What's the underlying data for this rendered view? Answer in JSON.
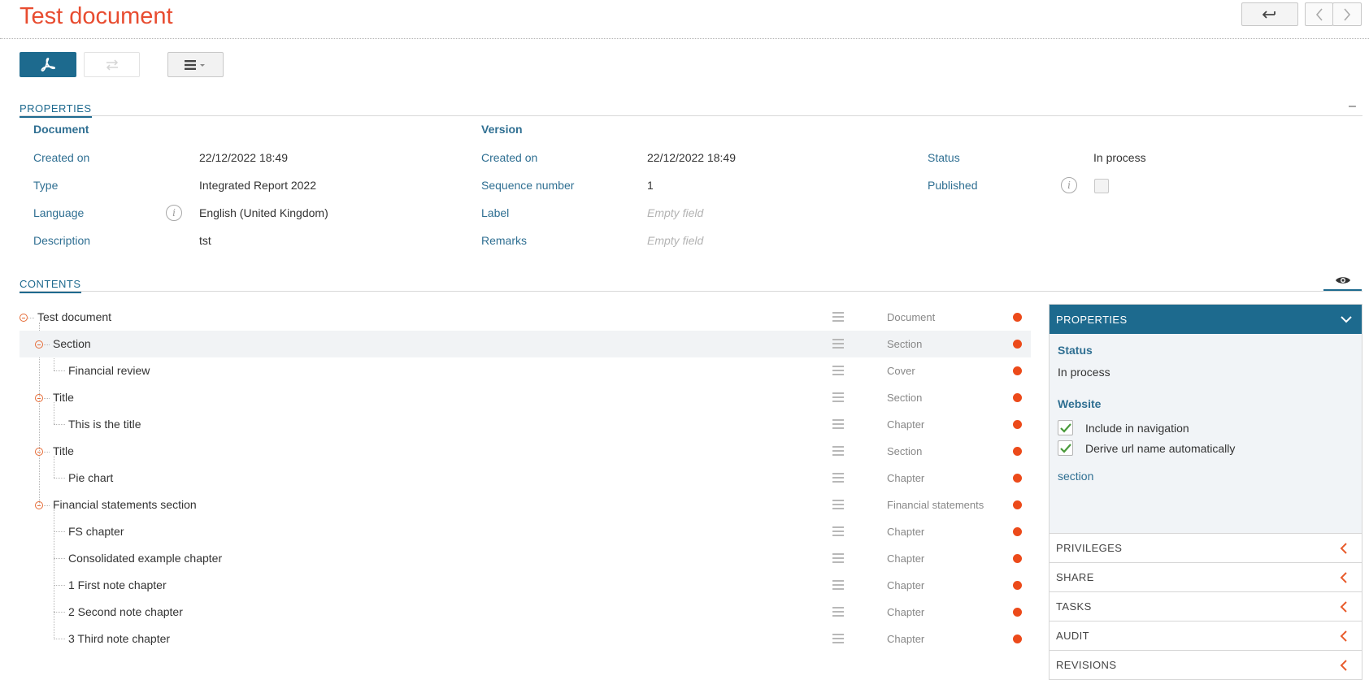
{
  "header": {
    "title": "Test document"
  },
  "nav": {
    "back_icon": "return-icon",
    "prev_icon": "chevron-left-icon",
    "next_icon": "chevron-right-icon"
  },
  "toolbar": {
    "pdf_icon": "pdf-icon",
    "swap_icon": "swap-icon",
    "menu_icon": "hamburger-menu-icon"
  },
  "properties": {
    "heading": "PROPERTIES",
    "collapse_symbol": "–",
    "document": {
      "heading": "Document",
      "rows": [
        {
          "label": "Created on",
          "value": "22/12/2022 18:49"
        },
        {
          "label": "Type",
          "value": "Integrated Report 2022"
        },
        {
          "label": "Language",
          "value": "English (United Kingdom)"
        },
        {
          "label": "Description",
          "value": "tst"
        }
      ]
    },
    "version": {
      "heading": "Version",
      "rows": [
        {
          "label": "Created on",
          "value": "22/12/2022 18:49"
        },
        {
          "label": "Sequence number",
          "value": "1"
        },
        {
          "label": "Label",
          "value": "Empty field"
        },
        {
          "label": "Remarks",
          "value": "Empty field"
        }
      ]
    },
    "status": {
      "rows": [
        {
          "label": "Status",
          "value": "In process"
        },
        {
          "label": "Published",
          "value": ""
        }
      ]
    }
  },
  "contents": {
    "heading": "CONTENTS",
    "rows": [
      {
        "label": "Test document",
        "type": "Document"
      },
      {
        "label": "Section",
        "type": "Section"
      },
      {
        "label": "Financial review",
        "type": "Cover"
      },
      {
        "label": "Title",
        "type": "Section"
      },
      {
        "label": "This is the title",
        "type": "Chapter"
      },
      {
        "label": "Title",
        "type": "Section"
      },
      {
        "label": "Pie chart",
        "type": "Chapter"
      },
      {
        "label": "Financial statements section",
        "type": "Financial statements"
      },
      {
        "label": "FS chapter",
        "type": "Chapter"
      },
      {
        "label": "Consolidated example chapter",
        "type": "Chapter"
      },
      {
        "label": "1 First note chapter",
        "type": "Chapter"
      },
      {
        "label": "2 Second note chapter",
        "type": "Chapter"
      },
      {
        "label": "3 Third note chapter",
        "type": "Chapter"
      }
    ]
  },
  "side_panel": {
    "header": "PROPERTIES",
    "status_heading": "Status",
    "status_value": "In process",
    "website_heading": "Website",
    "include_nav_label": "Include in navigation",
    "derive_url_label": "Derive url name automatically",
    "url_name": "section",
    "sections": [
      "PRIVILEGES",
      "SHARE",
      "TASKS",
      "AUDIT",
      "REVISIONS"
    ]
  },
  "colors": {
    "accent": "#1d6a8e",
    "title": "#e84c30",
    "status_dot": "#ec4a1a",
    "link": "#2f6f92"
  }
}
